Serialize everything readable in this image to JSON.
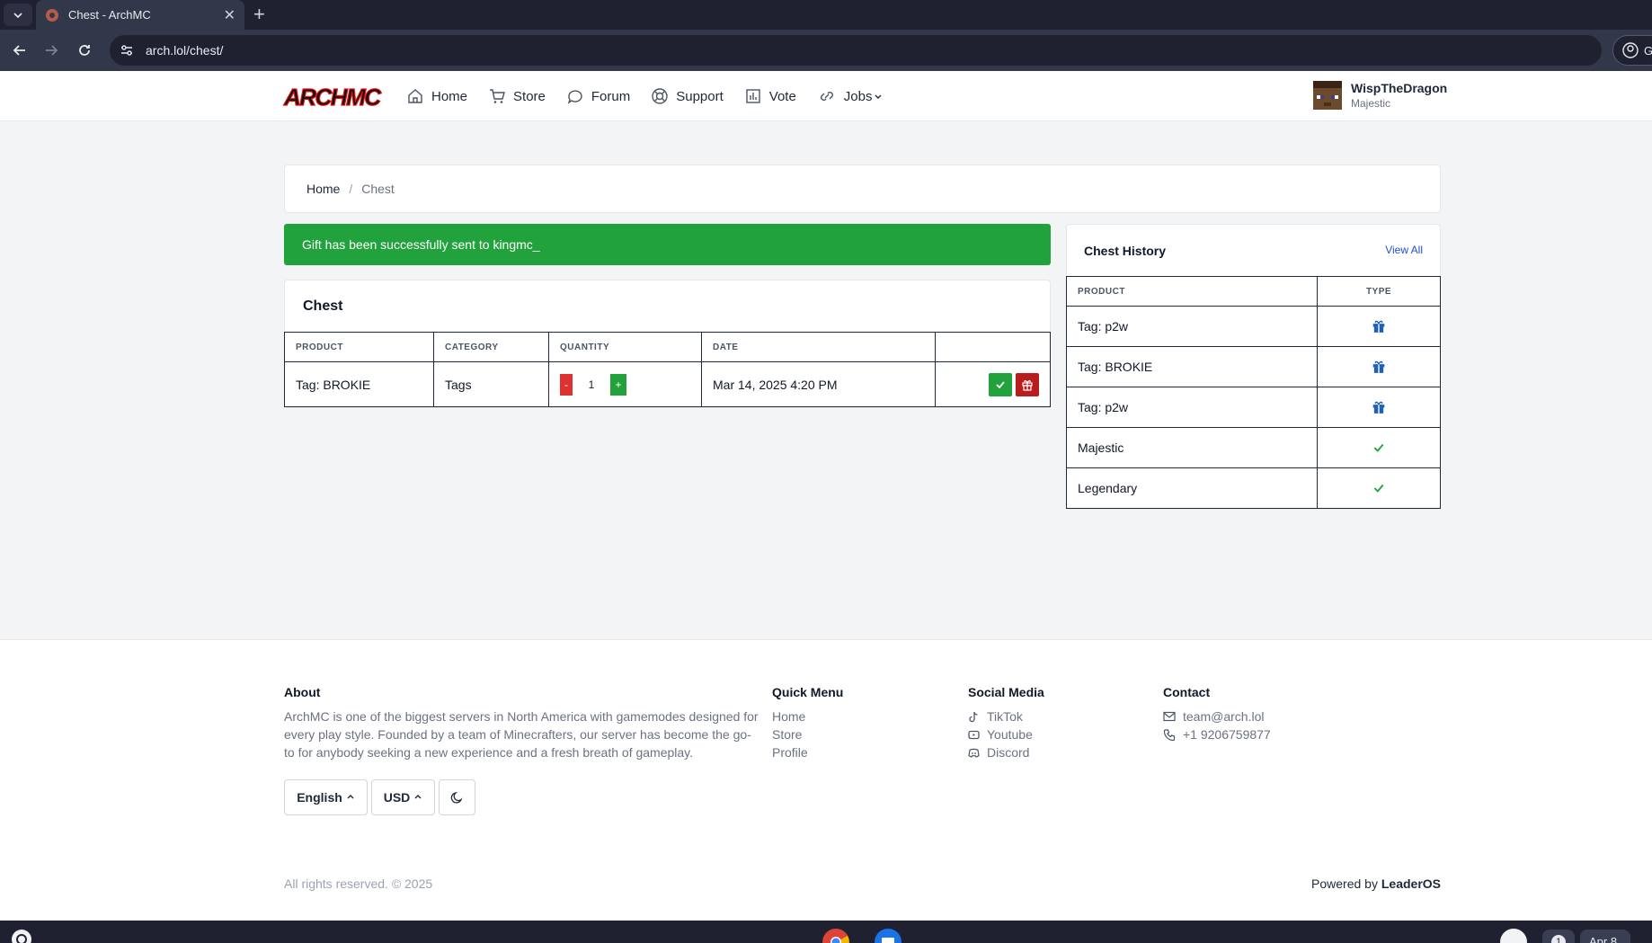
{
  "browser": {
    "tab_title": "Chest - ArchMC",
    "url": "arch.lol/chest/",
    "profile_letter": "G"
  },
  "header": {
    "logo_text": "ARCHMC",
    "nav": [
      {
        "label": "Home",
        "icon": "home-icon"
      },
      {
        "label": "Store",
        "icon": "cart-icon"
      },
      {
        "label": "Forum",
        "icon": "chat-icon"
      },
      {
        "label": "Support",
        "icon": "lifebuoy-icon"
      },
      {
        "label": "Vote",
        "icon": "chart-icon"
      },
      {
        "label": "Jobs",
        "icon": "link-icon"
      }
    ],
    "user": {
      "name": "WispTheDragon",
      "rank": "Majestic"
    }
  },
  "breadcrumb": {
    "home": "Home",
    "separator": "/",
    "current": "Chest"
  },
  "alert": {
    "message": "Gift has been successfully sent to kingmc_",
    "color": "#22a23c"
  },
  "chest": {
    "title": "Chest",
    "columns": [
      "PRODUCT",
      "CATEGORY",
      "QUANTITY",
      "DATE"
    ],
    "rows": [
      {
        "product": "Tag: BROKIE",
        "category": "Tags",
        "quantity_minus": "-",
        "quantity": "1",
        "quantity_plus": "+",
        "date": "Mar 14, 2025 4:20 PM"
      }
    ]
  },
  "history": {
    "title": "Chest History",
    "view_all": "View All",
    "columns": [
      "PRODUCT",
      "TYPE"
    ],
    "rows": [
      {
        "product": "Tag: p2w",
        "type_icon": "gift-icon"
      },
      {
        "product": "Tag: BROKIE",
        "type_icon": "gift-icon"
      },
      {
        "product": "Tag: p2w",
        "type_icon": "gift-icon"
      },
      {
        "product": "Majestic",
        "type_icon": "check-icon"
      },
      {
        "product": "Legendary",
        "type_icon": "check-icon"
      }
    ]
  },
  "footer": {
    "about": {
      "heading": "About",
      "text": "ArchMC is one of the biggest servers in North America with gamemodes designed for every play style. Founded by a team of Minecrafters, our server has become the go-to for anybody seeking a new experience and a fresh breath of gameplay."
    },
    "quick_menu": {
      "heading": "Quick Menu",
      "links": [
        "Home",
        "Store",
        "Profile"
      ]
    },
    "social": {
      "heading": "Social Media",
      "links": [
        "TikTok",
        "Youtube",
        "Discord"
      ]
    },
    "contact": {
      "heading": "Contact",
      "email": "team@arch.lol",
      "phone": "+1 9206759877"
    },
    "language": "English",
    "currency": "USD",
    "copyright": "All rights reserved. © 2025",
    "powered_prefix": "Powered by",
    "powered_brand": "LeaderOS"
  },
  "taskbar": {
    "date": "Apr 8",
    "notification_count": "1"
  }
}
